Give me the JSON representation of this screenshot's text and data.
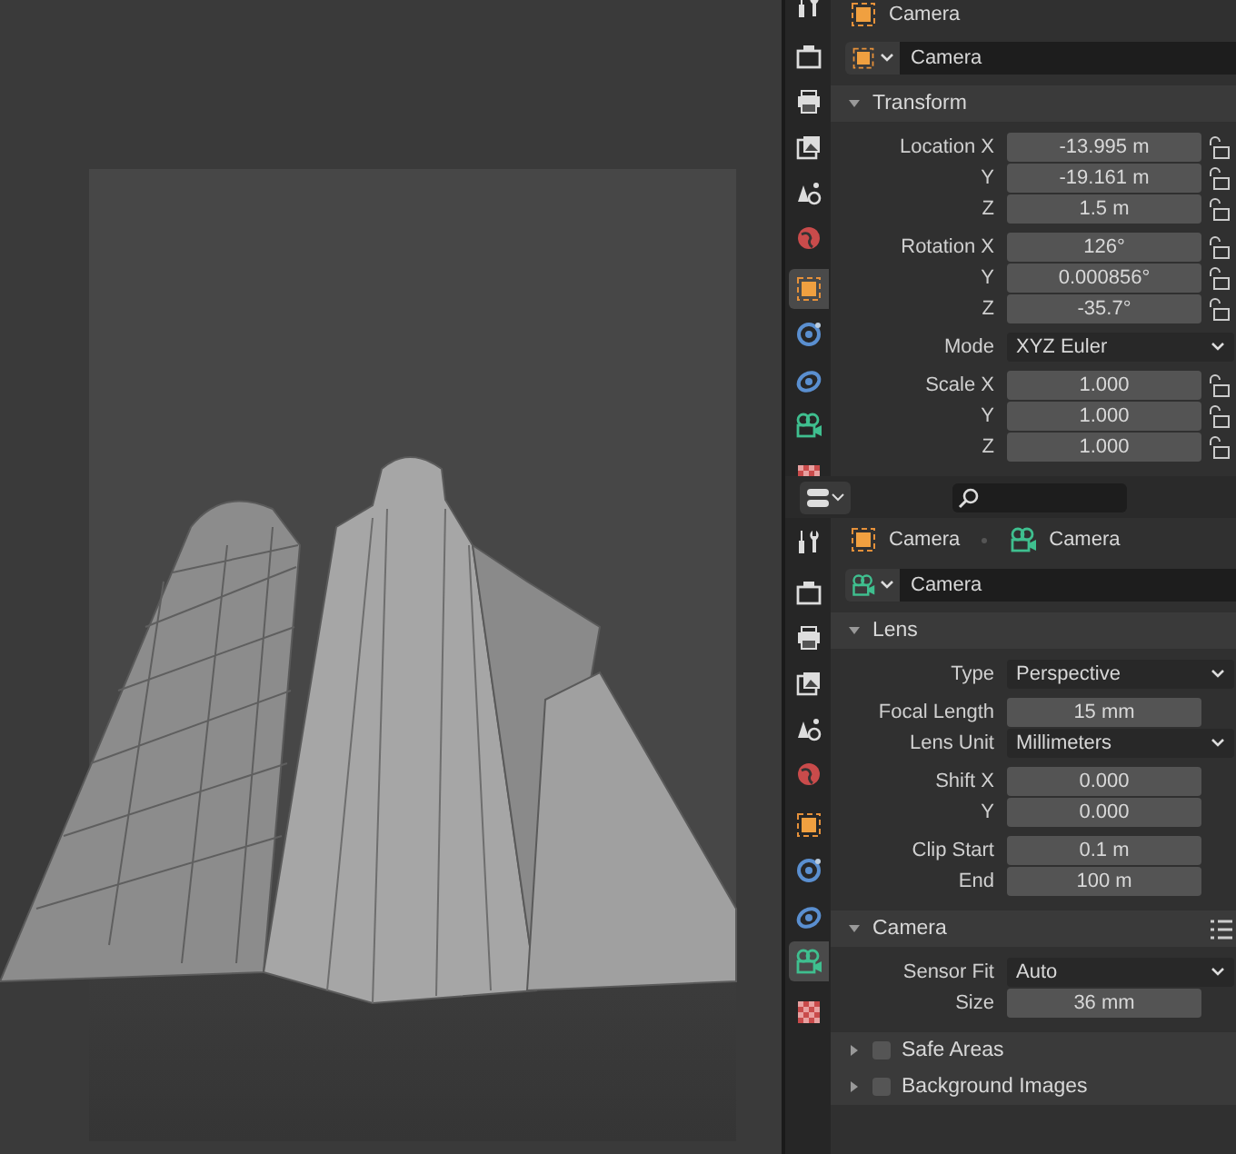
{
  "top_editor": {
    "tab_groups": [
      [
        {
          "kind": "tool",
          "selected": false
        }
      ],
      [
        {
          "kind": "render",
          "selected": false
        },
        {
          "kind": "output",
          "selected": false
        },
        {
          "kind": "view-layer",
          "selected": false
        },
        {
          "kind": "scene",
          "selected": false
        },
        {
          "kind": "world",
          "selected": false
        }
      ],
      [
        {
          "kind": "object",
          "selected": true
        },
        {
          "kind": "physics",
          "selected": false
        },
        {
          "kind": "constraints",
          "selected": false
        },
        {
          "kind": "camera-data",
          "selected": false
        }
      ],
      [
        {
          "kind": "texture",
          "selected": false
        }
      ]
    ],
    "breadcrumb": [
      {
        "kind": "object",
        "label": "Camera"
      }
    ],
    "datablock": {
      "kind": "object",
      "name": "Camera"
    },
    "panels": [
      {
        "title": "Transform",
        "expanded": true,
        "groups": [
          [
            {
              "label": "Location X",
              "kind": "number",
              "value": "-13.995 m",
              "locked": false
            },
            {
              "label": "Y",
              "kind": "number",
              "value": "-19.161 m",
              "locked": false
            },
            {
              "label": "Z",
              "kind": "number",
              "value": "1.5 m",
              "locked": false
            }
          ],
          [
            {
              "label": "Rotation X",
              "kind": "number",
              "value": "126°",
              "locked": false
            },
            {
              "label": "Y",
              "kind": "number",
              "value": "0.000856°",
              "locked": false
            },
            {
              "label": "Z",
              "kind": "number",
              "value": "-35.7°",
              "locked": false
            }
          ],
          [
            {
              "label": "Mode",
              "kind": "dropdown",
              "value": "XYZ Euler"
            }
          ],
          [
            {
              "label": "Scale X",
              "kind": "number",
              "value": "1.000",
              "locked": false
            },
            {
              "label": "Y",
              "kind": "number",
              "value": "1.000",
              "locked": false
            },
            {
              "label": "Z",
              "kind": "number",
              "value": "1.000",
              "locked": false
            }
          ]
        ]
      }
    ]
  },
  "bottom_editor": {
    "tab_groups": [
      [
        {
          "kind": "tool",
          "selected": false
        }
      ],
      [
        {
          "kind": "render",
          "selected": false
        },
        {
          "kind": "output",
          "selected": false
        },
        {
          "kind": "view-layer",
          "selected": false
        },
        {
          "kind": "scene",
          "selected": false
        },
        {
          "kind": "world",
          "selected": false
        }
      ],
      [
        {
          "kind": "object",
          "selected": false
        },
        {
          "kind": "physics",
          "selected": false
        },
        {
          "kind": "constraints",
          "selected": false
        },
        {
          "kind": "camera-data",
          "selected": true
        }
      ],
      [
        {
          "kind": "texture",
          "selected": false
        }
      ]
    ],
    "breadcrumb": [
      {
        "kind": "object",
        "label": "Camera"
      },
      {
        "kind": "camera-data",
        "label": "Camera"
      }
    ],
    "datablock": {
      "kind": "camera-data",
      "name": "Camera"
    },
    "panels": [
      {
        "title": "Lens",
        "expanded": true,
        "groups": [
          [
            {
              "label": "Type",
              "kind": "dropdown",
              "value": "Perspective"
            }
          ],
          [
            {
              "label": "Focal Length",
              "kind": "number",
              "value": "15 mm"
            },
            {
              "label": "Lens Unit",
              "kind": "dropdown",
              "value": "Millimeters"
            }
          ],
          [
            {
              "label": "Shift X",
              "kind": "number",
              "value": "0.000"
            },
            {
              "label": "Y",
              "kind": "number",
              "value": "0.000"
            }
          ],
          [
            {
              "label": "Clip Start",
              "kind": "number",
              "value": "0.1 m"
            },
            {
              "label": "End",
              "kind": "number",
              "value": "100 m"
            }
          ]
        ]
      },
      {
        "title": "Camera",
        "expanded": true,
        "presets": true,
        "groups": [
          [
            {
              "label": "Sensor Fit",
              "kind": "dropdown",
              "value": "Auto"
            },
            {
              "label": "Size",
              "kind": "number",
              "value": "36 mm"
            }
          ]
        ]
      },
      {
        "title": "Safe Areas",
        "expanded": false,
        "checkbox": true,
        "checked": false
      },
      {
        "title": "Background Images",
        "expanded": false,
        "checkbox": true,
        "checked": false
      }
    ]
  }
}
